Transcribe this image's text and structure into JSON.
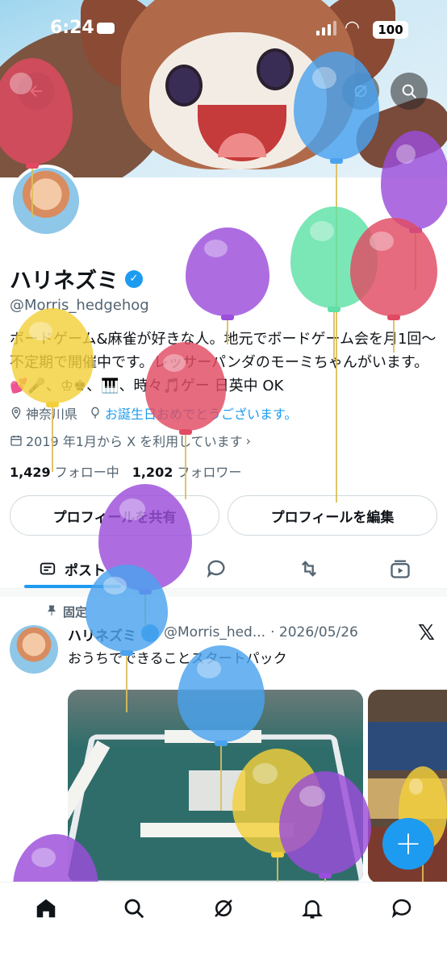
{
  "status_bar": {
    "time": "6:24",
    "battery": "100"
  },
  "profile": {
    "name": "ハリネズミ",
    "handle": "@Morris_hedgehog",
    "bio": "ボードゲーム&麻雀が好きな人。地元でボードゲーム会を月1回〜不定期で開催中です。レッサーパンダのモーミちゃんがいます。💕🎤、♔♚、🎹、時々🎵ゲー 日英中 OK",
    "location": "神奈川県",
    "birthday_text": "お誕生日おめでとうございます。",
    "joined": "2019 年1月から X を利用しています",
    "following_count": "1,429",
    "following_label": "フォロー中",
    "followers_count": "1,202",
    "followers_label": "フォロワー",
    "share_button": "プロフィールを共有",
    "edit_button": "プロフィールを編集"
  },
  "tabs": {
    "posts": "ポスト"
  },
  "post": {
    "pinned_label": "固定",
    "author": "ハリネズミ",
    "handle": "@Morris_hed...",
    "date": "· 2026/05/26",
    "text": "おうちでできることスタートパック"
  },
  "fab": {
    "label": "+"
  },
  "colors": {
    "accent": "#1d9bf0",
    "text": "#0f1419",
    "muted": "#536471"
  },
  "icons": [
    "back-arrow-icon",
    "grok-icon",
    "search-icon",
    "location-icon",
    "balloon-icon",
    "calendar-icon",
    "posts-icon",
    "reply-icon",
    "repost-icon",
    "media-icon",
    "pin-icon",
    "x-logo-icon",
    "home-icon",
    "explore-icon",
    "grok-nav-icon",
    "notifications-icon",
    "messages-icon"
  ]
}
